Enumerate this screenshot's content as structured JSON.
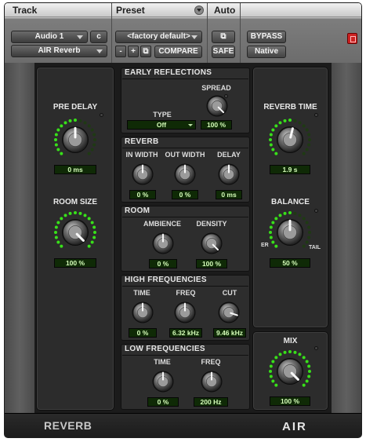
{
  "header": {
    "track_label": "Track",
    "preset_label": "Preset",
    "auto_label": "Auto",
    "track_name": "Audio 1",
    "channel": "c",
    "plugin_name": "AIR Reverb",
    "preset": "<factory default>",
    "minus": "-",
    "plus": "+",
    "compare": "COMPARE",
    "bypass": "BYPASS",
    "safe": "SAFE",
    "native": "Native"
  },
  "accent": "#38e01a",
  "left": {
    "pre_delay": {
      "label": "PRE DELAY",
      "value": "0 ms",
      "level": 0.5
    },
    "room_size": {
      "label": "ROOM SIZE",
      "value": "100 %",
      "level": 1.0
    }
  },
  "sections": {
    "early": {
      "title": "EARLY REFLECTIONS",
      "spread_label": "SPREAD",
      "spread_value": "100 %",
      "type_label": "TYPE",
      "type_value": "Off"
    },
    "reverb": {
      "title": "REVERB",
      "in_label": "IN WIDTH",
      "in_value": "0 %",
      "out_label": "OUT WIDTH",
      "out_value": "0 %",
      "delay_label": "DELAY",
      "delay_value": "0 ms"
    },
    "room": {
      "title": "ROOM",
      "amb_label": "AMBIENCE",
      "amb_value": "0 %",
      "dens_label": "DENSITY",
      "dens_value": "100 %"
    },
    "high": {
      "title": "HIGH FREQUENCIES",
      "time_label": "TIME",
      "time_value": "0 %",
      "freq_label": "FREQ",
      "freq_value": "6.32 kHz",
      "cut_label": "CUT",
      "cut_value": "9.46 kHz"
    },
    "low": {
      "title": "LOW FREQUENCIES",
      "time_label": "TIME",
      "time_value": "0 %",
      "freq_label": "FREQ",
      "freq_value": "200 Hz"
    }
  },
  "right": {
    "reverb_time": {
      "label": "REVERB TIME",
      "value": "1.9 s",
      "level": 0.55
    },
    "balance": {
      "label": "BALANCE",
      "value": "50 %",
      "left": "ER",
      "right": "TAIL",
      "level": 0.5
    },
    "mix": {
      "label": "MIX",
      "value": "100 %",
      "level": 1.0
    }
  },
  "footer": {
    "name": "REVERB",
    "logo": "AIR"
  }
}
